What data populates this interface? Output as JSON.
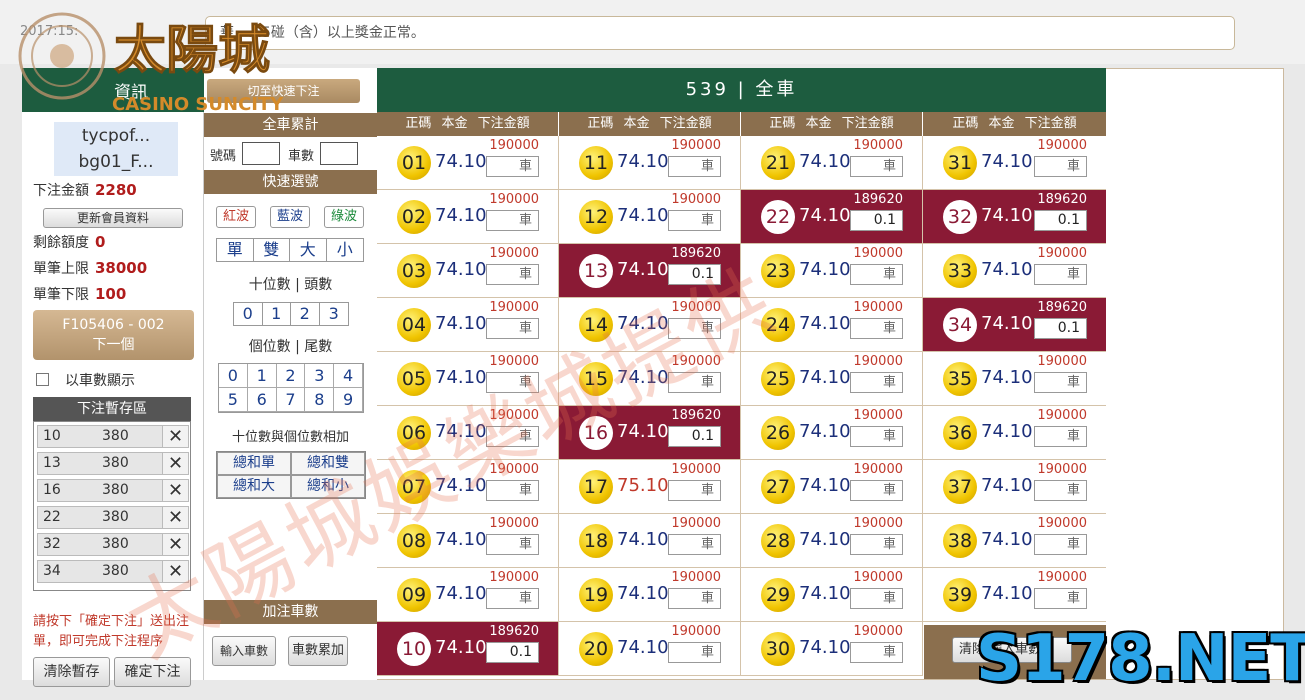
{
  "top": {
    "timestamp": "2017:15:",
    "marquee": "華，…5碰（含）以上獎金正常。"
  },
  "logo": {
    "text_cn": "太陽城",
    "text_en": "CASINO SUNCITY"
  },
  "left": {
    "header": "資訊",
    "user_line1": "tycpof...",
    "user_line2": "bg01_F...",
    "stake_label": "下注金額",
    "stake_value": "2280",
    "update_btn": "更新會員資料",
    "remain_label": "剩餘額度",
    "remain_value": "0",
    "max_label": "單筆上限",
    "max_value": "38000",
    "min_label": "單筆下限",
    "min_value": "100",
    "next_line1": "F105406 - 002",
    "next_line2": "下一個",
    "by_count_label": "以車數顯示",
    "temp_header": "下注暫存區",
    "temp_rows": [
      {
        "n": "10",
        "v": "380"
      },
      {
        "n": "13",
        "v": "380"
      },
      {
        "n": "16",
        "v": "380"
      },
      {
        "n": "22",
        "v": "380"
      },
      {
        "n": "32",
        "v": "380"
      },
      {
        "n": "34",
        "v": "380"
      }
    ],
    "remove_symbol": "✕",
    "hint": "請按下「確定下注」送出注單，即可完成下注程序",
    "clear_temp_btn": "清除暫存",
    "confirm_btn": "確定下注"
  },
  "mid": {
    "switch_btn": "切至快速下注",
    "total_hdr": "全車累計",
    "num_label": "號碼",
    "count_label": "車數",
    "quick_hdr": "快速選號",
    "waves": [
      "紅波",
      "藍波",
      "綠波"
    ],
    "seg1": [
      "單",
      "雙",
      "大",
      "小"
    ],
    "tens_label": "十位數 | 頭數",
    "tens": [
      "0",
      "1",
      "2",
      "3"
    ],
    "units_label": "個位數 | 尾數",
    "units": [
      "0",
      "1",
      "2",
      "3",
      "4",
      "5",
      "6",
      "7",
      "8",
      "9"
    ],
    "sum_label": "十位數與個位數相加",
    "sum_btns": [
      "總和單",
      "總和雙",
      "總和大",
      "總和小"
    ],
    "add_hdr": "加注車數",
    "input_btn": "輸入車數",
    "acc_btn": "車數累加"
  },
  "main": {
    "title": "539 | 全車",
    "col_header": "正碼 本金 下注金額",
    "unit": "車",
    "clear_btn": "清除 輸入車數",
    "cells": [
      {
        "n": "01",
        "o": "74.10",
        "l": "190000",
        "a": "車",
        "s": false
      },
      {
        "n": "02",
        "o": "74.10",
        "l": "190000",
        "a": "車",
        "s": false
      },
      {
        "n": "03",
        "o": "74.10",
        "l": "190000",
        "a": "車",
        "s": false
      },
      {
        "n": "04",
        "o": "74.10",
        "l": "190000",
        "a": "車",
        "s": false
      },
      {
        "n": "05",
        "o": "74.10",
        "l": "190000",
        "a": "車",
        "s": false
      },
      {
        "n": "06",
        "o": "74.10",
        "l": "190000",
        "a": "車",
        "s": false
      },
      {
        "n": "07",
        "o": "74.10",
        "l": "190000",
        "a": "車",
        "s": false
      },
      {
        "n": "08",
        "o": "74.10",
        "l": "190000",
        "a": "車",
        "s": false
      },
      {
        "n": "09",
        "o": "74.10",
        "l": "190000",
        "a": "車",
        "s": false
      },
      {
        "n": "10",
        "o": "74.10",
        "l": "189620",
        "a": "0.1",
        "s": true
      },
      {
        "n": "11",
        "o": "74.10",
        "l": "190000",
        "a": "車",
        "s": false
      },
      {
        "n": "12",
        "o": "74.10",
        "l": "190000",
        "a": "車",
        "s": false
      },
      {
        "n": "13",
        "o": "74.10",
        "l": "189620",
        "a": "0.1",
        "s": true
      },
      {
        "n": "14",
        "o": "74.10",
        "l": "190000",
        "a": "車",
        "s": false
      },
      {
        "n": "15",
        "o": "74.10",
        "l": "190000",
        "a": "車",
        "s": false
      },
      {
        "n": "16",
        "o": "74.10",
        "l": "189620",
        "a": "0.1",
        "s": true
      },
      {
        "n": "17",
        "o": "75.10",
        "l": "190000",
        "a": "車",
        "s": false,
        "red": true
      },
      {
        "n": "18",
        "o": "74.10",
        "l": "190000",
        "a": "車",
        "s": false
      },
      {
        "n": "19",
        "o": "74.10",
        "l": "190000",
        "a": "車",
        "s": false
      },
      {
        "n": "20",
        "o": "74.10",
        "l": "190000",
        "a": "車",
        "s": false
      },
      {
        "n": "21",
        "o": "74.10",
        "l": "190000",
        "a": "車",
        "s": false
      },
      {
        "n": "22",
        "o": "74.10",
        "l": "189620",
        "a": "0.1",
        "s": true
      },
      {
        "n": "23",
        "o": "74.10",
        "l": "190000",
        "a": "車",
        "s": false
      },
      {
        "n": "24",
        "o": "74.10",
        "l": "190000",
        "a": "車",
        "s": false
      },
      {
        "n": "25",
        "o": "74.10",
        "l": "190000",
        "a": "車",
        "s": false
      },
      {
        "n": "26",
        "o": "74.10",
        "l": "190000",
        "a": "車",
        "s": false
      },
      {
        "n": "27",
        "o": "74.10",
        "l": "190000",
        "a": "車",
        "s": false
      },
      {
        "n": "28",
        "o": "74.10",
        "l": "190000",
        "a": "車",
        "s": false
      },
      {
        "n": "29",
        "o": "74.10",
        "l": "190000",
        "a": "車",
        "s": false
      },
      {
        "n": "30",
        "o": "74.10",
        "l": "190000",
        "a": "車",
        "s": false
      },
      {
        "n": "31",
        "o": "74.10",
        "l": "190000",
        "a": "車",
        "s": false
      },
      {
        "n": "32",
        "o": "74.10",
        "l": "189620",
        "a": "0.1",
        "s": true
      },
      {
        "n": "33",
        "o": "74.10",
        "l": "190000",
        "a": "車",
        "s": false
      },
      {
        "n": "34",
        "o": "74.10",
        "l": "189620",
        "a": "0.1",
        "s": true
      },
      {
        "n": "35",
        "o": "74.10",
        "l": "190000",
        "a": "車",
        "s": false
      },
      {
        "n": "36",
        "o": "74.10",
        "l": "190000",
        "a": "車",
        "s": false
      },
      {
        "n": "37",
        "o": "74.10",
        "l": "190000",
        "a": "車",
        "s": false
      },
      {
        "n": "38",
        "o": "74.10",
        "l": "190000",
        "a": "車",
        "s": false
      },
      {
        "n": "39",
        "o": "74.10",
        "l": "190000",
        "a": "車",
        "s": false
      }
    ]
  },
  "watermark": "太陽城娛樂城提供",
  "site_watermark": "S178.NET",
  "colors": {
    "green": "#1d5c3f",
    "brown": "#8b6f4e",
    "selected": "#8a1a35",
    "ball": "#f0c400",
    "limit_red": "#c0392b"
  }
}
